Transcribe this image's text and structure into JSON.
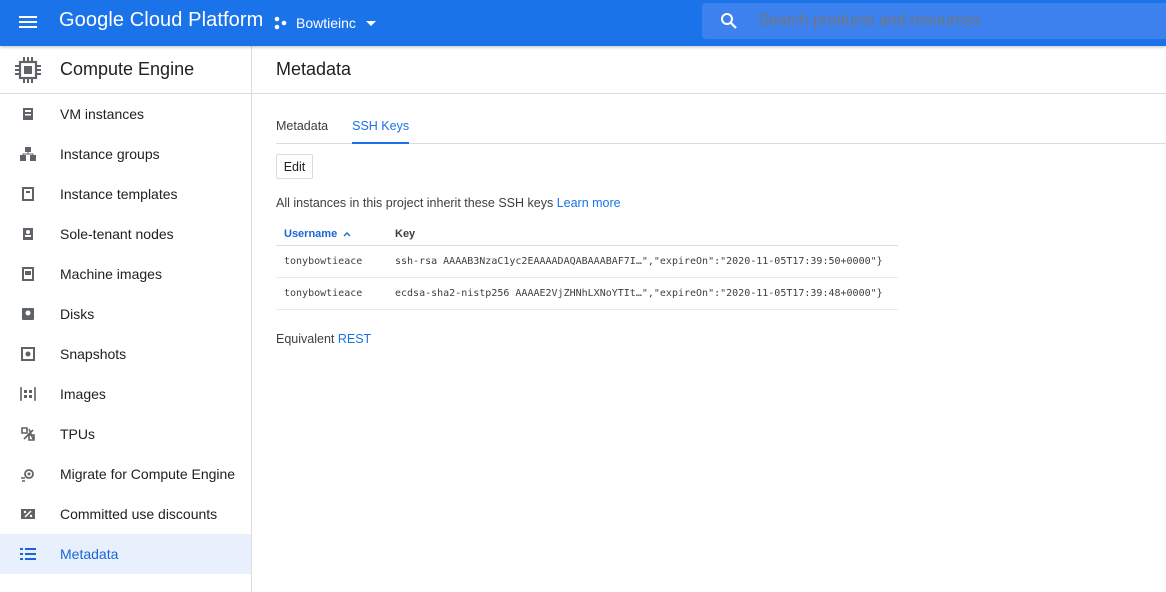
{
  "topbar": {
    "brand": "Google Cloud Platform",
    "project_name": "Bowtieinc",
    "search_placeholder": "Search products and resources"
  },
  "sidebar": {
    "product_title": "Compute Engine",
    "items": [
      {
        "label": "VM instances",
        "icon": "vm-instances-icon"
      },
      {
        "label": "Instance groups",
        "icon": "instance-groups-icon"
      },
      {
        "label": "Instance templates",
        "icon": "instance-templates-icon"
      },
      {
        "label": "Sole-tenant nodes",
        "icon": "sole-tenant-nodes-icon"
      },
      {
        "label": "Machine images",
        "icon": "machine-images-icon"
      },
      {
        "label": "Disks",
        "icon": "disks-icon"
      },
      {
        "label": "Snapshots",
        "icon": "snapshots-icon"
      },
      {
        "label": "Images",
        "icon": "images-icon"
      },
      {
        "label": "TPUs",
        "icon": "tpus-icon"
      },
      {
        "label": "Migrate for Compute Engine",
        "icon": "migrate-icon"
      },
      {
        "label": "Committed use discounts",
        "icon": "committed-use-discounts-icon"
      },
      {
        "label": "Metadata",
        "icon": "metadata-icon",
        "active": true
      }
    ]
  },
  "main": {
    "title": "Metadata",
    "tabs": [
      {
        "label": "Metadata",
        "active": false
      },
      {
        "label": "SSH Keys",
        "active": true
      }
    ],
    "edit_label": "Edit",
    "info_text": "All instances in this project inherit these SSH keys",
    "learn_more": "Learn more",
    "table": {
      "columns": [
        "Username",
        "Key"
      ],
      "rows": [
        {
          "username": "tonybowtieace",
          "key": "ssh-rsa AAAAB3NzaC1yc2EAAAADAQABAAABAF7I…\",\"expireOn\":\"2020-11-05T17:39:50+0000\"}"
        },
        {
          "username": "tonybowtieace",
          "key": "ecdsa-sha2-nistp256 AAAAE2VjZHNhLXNoYTIt…\",\"expireOn\":\"2020-11-05T17:39:48+0000\"}"
        }
      ]
    },
    "equivalent_label": "Equivalent",
    "rest_link": "REST"
  },
  "colors": {
    "topbar": "#1a73e8",
    "accent": "#1a73e8",
    "active_nav_bg": "#e8f0fe"
  }
}
